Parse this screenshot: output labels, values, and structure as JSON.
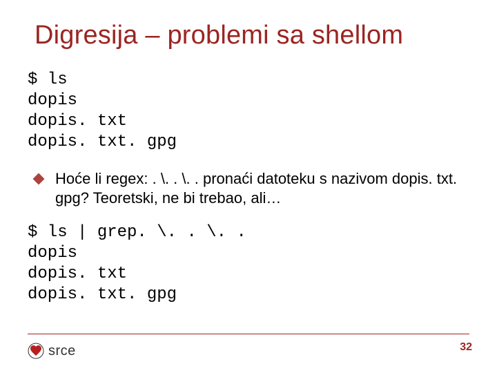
{
  "title": "Digresija – problemi sa shellom",
  "code1": "$ ls\ndopis\ndopis. txt\ndopis. txt. gpg",
  "bullet": "Hoće li regex: . \\. . \\. . pronaći datoteku s nazivom dopis. txt. gpg? Teoretski, ne bi trebao, ali…",
  "code2": "$ ls | grep. \\. . \\. .\ndopis\ndopis. txt\ndopis. txt. gpg",
  "page_number": "32",
  "logo_text": "srce"
}
